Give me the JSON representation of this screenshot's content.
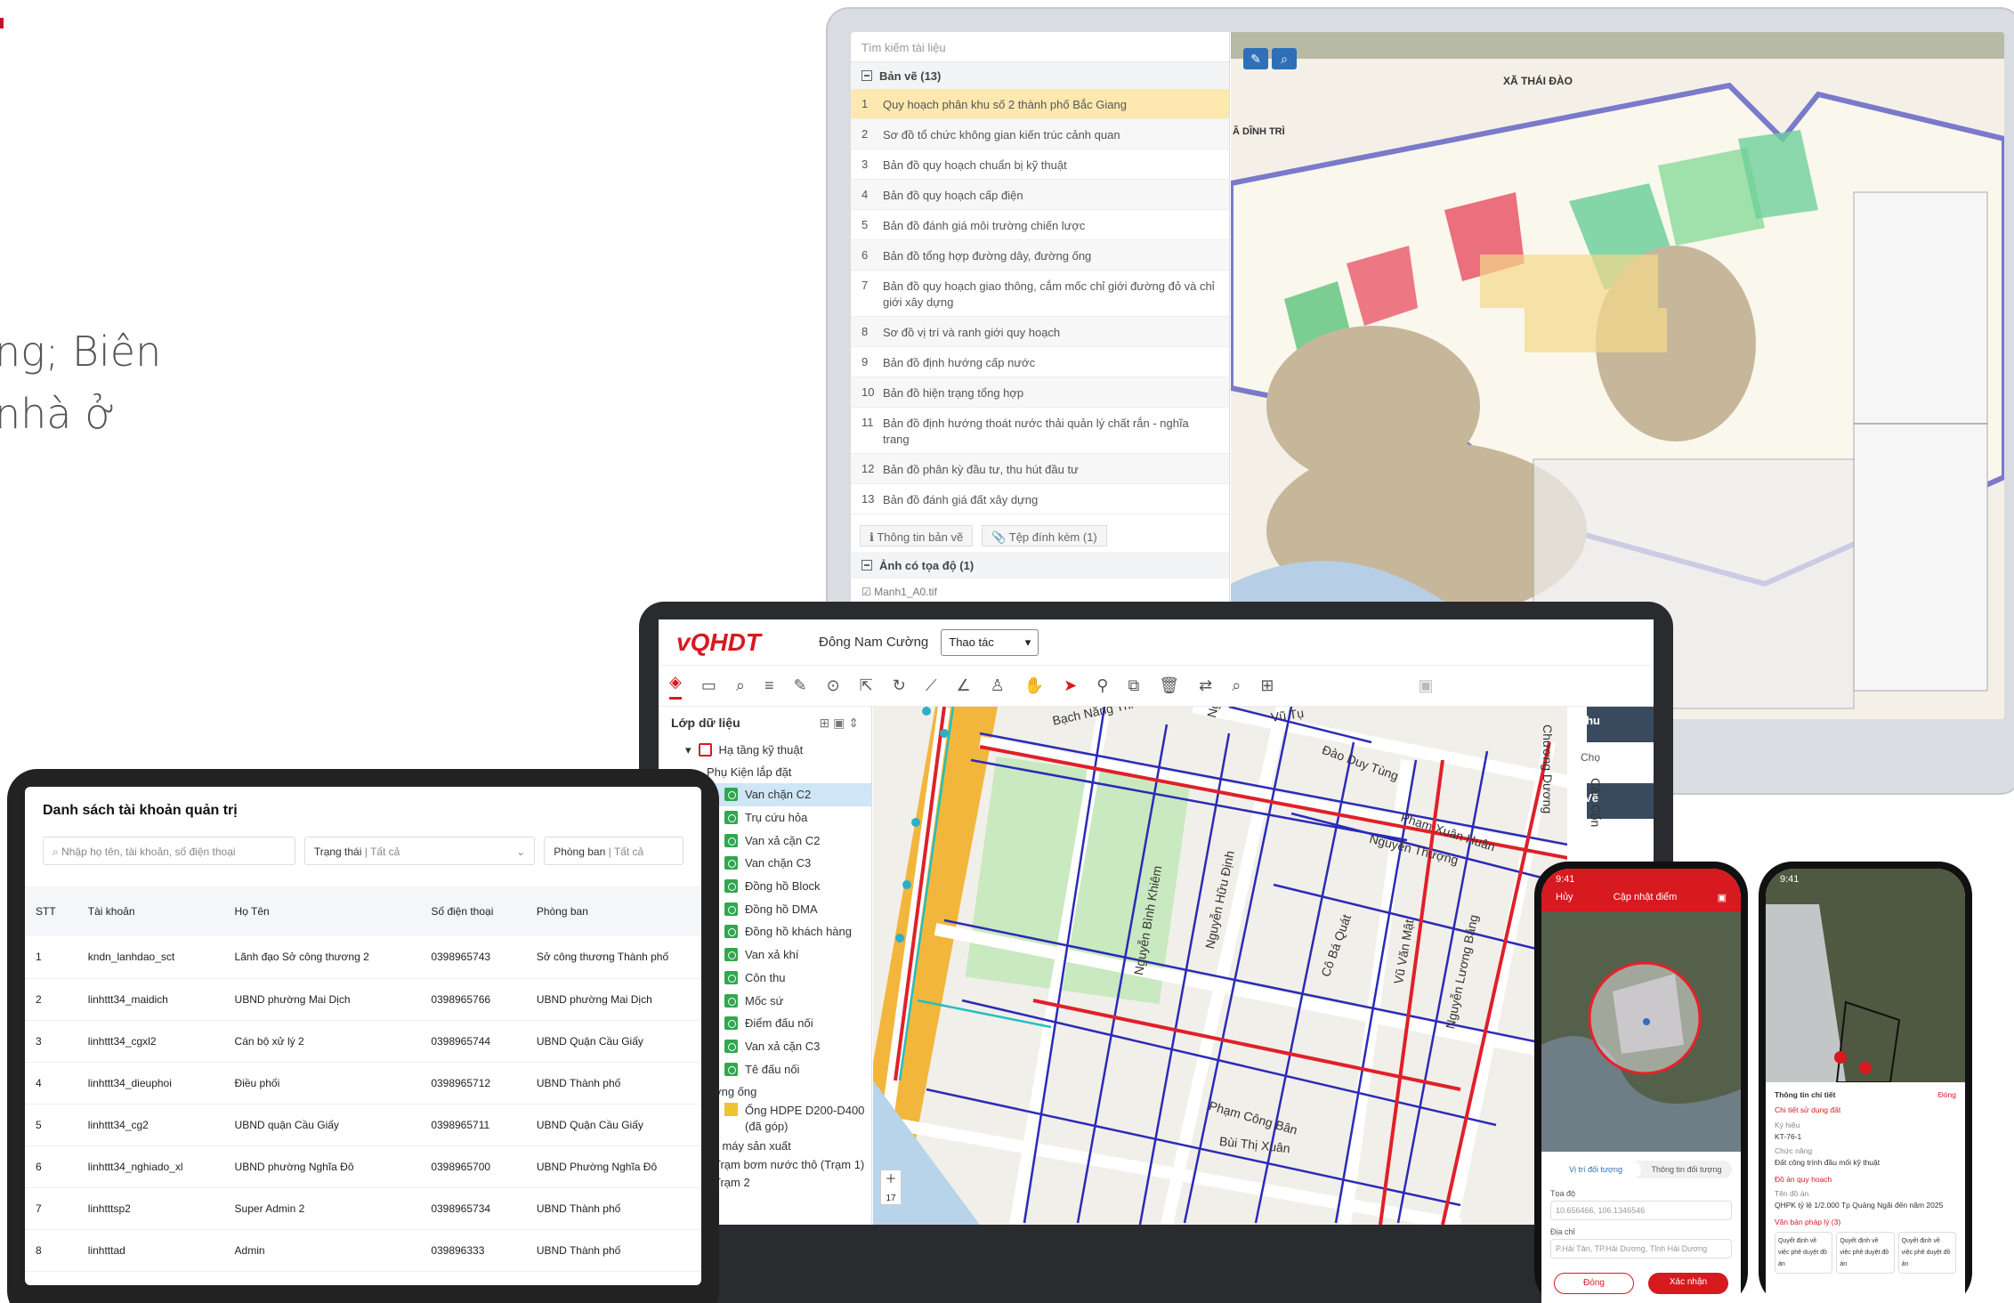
{
  "hero": {
    "line1": "ng; Biên",
    "line2": "nhà ở"
  },
  "colors": {
    "brand": "#d71920",
    "accent": "#2e6fb8",
    "highlight": "#fde9b0"
  },
  "monitor": {
    "search_placeholder": "Tìm kiếm tài liệu",
    "group_label": "Bản vẽ (13)",
    "docs": [
      {
        "num": "1",
        "name": "Quy hoạch phân khu số 2 thành phố Bắc Giang"
      },
      {
        "num": "2",
        "name": "Sơ đồ tổ chức không gian kiến trúc cảnh quan"
      },
      {
        "num": "3",
        "name": "Bản đồ quy hoạch chuẩn bị kỹ thuật"
      },
      {
        "num": "4",
        "name": "Bản đồ quy hoạch cấp điện"
      },
      {
        "num": "5",
        "name": "Bản đồ đánh giá môi trường chiến lược"
      },
      {
        "num": "6",
        "name": "Bản đồ tổng hợp đường dây, đường ống"
      },
      {
        "num": "7",
        "name": "Bản đồ quy hoạch giao thông, cắm mốc chỉ giới đường đỏ và chỉ giới xây dựng"
      },
      {
        "num": "8",
        "name": "Sơ đồ vị trí và ranh giới quy hoạch"
      },
      {
        "num": "9",
        "name": "Bản đồ định hướng cấp nước"
      },
      {
        "num": "10",
        "name": "Bản đồ hiện trạng tổng hợp"
      },
      {
        "num": "11",
        "name": "Bản đồ định hướng thoát nước thải quản lý chất rắn - nghĩa trang"
      },
      {
        "num": "12",
        "name": "Bản đồ phân kỳ đầu tư, thu hút đầu tư"
      },
      {
        "num": "13",
        "name": "Bản đồ đánh giá đất xây dựng"
      }
    ],
    "tab_info": "Thông tin bản vẽ",
    "tab_attach": "Tệp đính kèm (1)",
    "group2_label": "Ảnh có tọa độ (1)",
    "file_name": "Manh1_A0.tif",
    "map_label_1": "XÃ THÁI ĐÀO",
    "map_label_2": "Ã DĨNH TRÌ"
  },
  "laptop": {
    "logo": "vQHDT",
    "user": "Đông Nam Cường",
    "action_select": "Thao tác",
    "sidebar_title": "Lớp dữ liệu",
    "layer_root": "Hạ tầng kỹ thuật",
    "layer_sub": "Phụ Kiện lắp đặt",
    "layers": [
      "Van chặn C2",
      "Trụ cứu hỏa",
      "Van xả cặn C2",
      "Van chặn C3",
      "Đồng hồ Block",
      "Đồng hồ DMA",
      "Đồng hồ khách hàng",
      "Van xả khí",
      "Côn thu",
      "Mốc sứ",
      "Điểm đấu nối",
      "Van xả cặn C3",
      "Tê đấu nối"
    ],
    "layer_group2": "Đường ống",
    "pipe_layer": "Ống HDPE D200-D400 (đã góp)",
    "layer_group3": "Nhà máy sản xuất",
    "plant_layer": "Trạm bơm nước thô (Trạm 1)",
    "plant_layer2": "Trạm 2",
    "streets": [
      "Bạch Năng Thi",
      "Nguyễn Thị Duệ",
      "Vũ Tụ",
      "Đào Duy Tùng",
      "Phạm Xuân Huân",
      "Nguyễn Bình Khiêm",
      "Nguyễn Hữu Định",
      "Cô Bá Quát",
      "Vũ Văn Mật",
      "Phạm Công Bân",
      "Bùi Thị Xuân",
      "Chương Dương",
      "Cầu Cốn",
      "Nguyễn Lương Bằng",
      "Nguyễn Thượng"
    ],
    "zoom_label": "17",
    "panel_title": "Thu",
    "panel_sub": "Chọ",
    "panel_btn": "Vẽ"
  },
  "tablet": {
    "title": "Danh sách tài khoản quản trị",
    "search_placeholder": "Nhập họ tên, tài khoản, số điện thoại",
    "status_label": "Trạng thái",
    "status_value": "Tất cả",
    "dept_label": "Phòng ban",
    "dept_value": "Tất cả",
    "columns": [
      "STT",
      "Tài khoản",
      "Họ Tên",
      "Số điện thoại",
      "Phòng ban"
    ],
    "rows": [
      [
        "1",
        "kndn_lanhdao_sct",
        "Lãnh đạo Sở công thương 2",
        "0398965743",
        "Sở công thương Thành phố"
      ],
      [
        "2",
        "linhttt34_maidich",
        "UBND phường Mai Dịch",
        "0398965766",
        "UBND phường Mai Dịch"
      ],
      [
        "3",
        "linhttt34_cgxl2",
        "Cán bộ xử lý 2",
        "0398965744",
        "UBND Quận Cầu Giấy"
      ],
      [
        "4",
        "linhttt34_dieuphoi",
        "Điều phối",
        "0398965712",
        "UBND Thành phố"
      ],
      [
        "5",
        "linhttt34_cg2",
        "UBND quận Cầu Giấy",
        "0398965711",
        "UBND Quận Cầu Giấy"
      ],
      [
        "6",
        "linhttt34_nghiado_xl",
        "UBND phường Nghĩa Đô",
        "0398965700",
        "UBND Phường Nghĩa Đô"
      ],
      [
        "7",
        "linhtttsp2",
        "Super Admin 2",
        "0398965734",
        "UBND Thành phố"
      ],
      [
        "8",
        "linhtttad",
        "Admin",
        "039896333",
        "UBND Thành phố"
      ]
    ]
  },
  "phone1": {
    "time": "9:41",
    "back": "Hủy",
    "title": "Cập nhật điểm",
    "tab_a": "Vị trí đối tượng",
    "tab_b": "Thông tin đối tượng",
    "coord_label": "Tọa độ",
    "coord_value": "10.656466, 106.1346546",
    "addr_label": "Địa chỉ",
    "addr_value": "P.Hải Tân, TP.Hải Dương, Tỉnh Hải Dương",
    "cancel": "Đóng",
    "confirm": "Xác nhận"
  },
  "phone2": {
    "time": "9:41",
    "title": "Thông tin chi tiết",
    "close": "Đóng",
    "section1": "Chi tiết sử dụng đất",
    "code_label": "Ký hiệu",
    "code_value": "KT-76-1",
    "func_label": "Chức năng",
    "func_value": "Đất công trình đầu mối kỹ thuật",
    "section2": "Đồ án quy hoạch",
    "plan_label": "Tên đồ án",
    "plan_value": "QHPK tỷ lệ 1/2.000 Tp Quảng Ngãi đến năm 2025",
    "section3": "Văn bản pháp lý (3)",
    "doc_item": "Quyết định về việc phê duyệt đồ án"
  }
}
